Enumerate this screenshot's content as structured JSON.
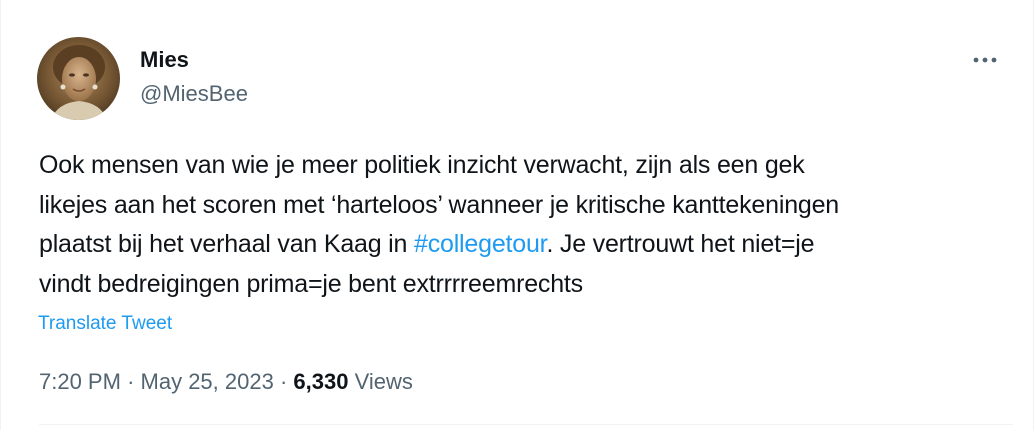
{
  "author": {
    "display_name": "Mies",
    "handle": "@MiesBee"
  },
  "tweet": {
    "lines": [
      "Ook mensen van wie je meer politiek inzicht verwacht, zijn als een gek",
      "likejes aan het scoren met ‘harteloos’ wanneer je kritische kanttekeningen",
      "plaatst bij het verhaal van Kaag in ",
      "#collegetour",
      ". Je vertrouwt het niet=je",
      "vindt bedreigingen prima=je bent extrrrreemrechts"
    ],
    "translate_label": "Translate Tweet"
  },
  "meta": {
    "time": "7:20 PM",
    "separator": "·",
    "date": "May 25, 2023",
    "views_count": "6,330",
    "views_label": "Views"
  },
  "icons": {
    "avatar": "avatar-photo",
    "more": "more-options-icon"
  },
  "colors": {
    "accent": "#1d9bf0",
    "text_primary": "#0f1419",
    "text_secondary": "#536471",
    "border": "#eff3f4"
  }
}
